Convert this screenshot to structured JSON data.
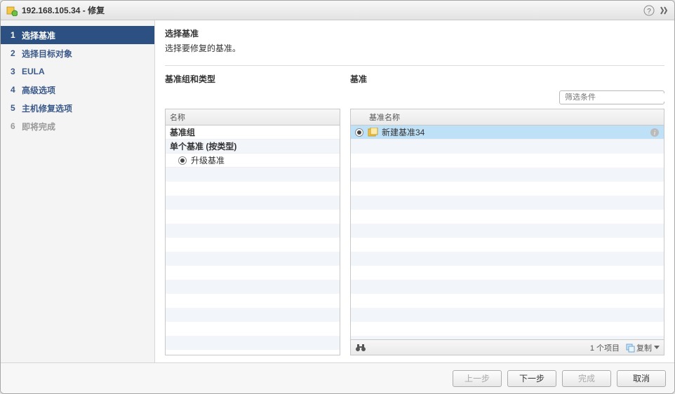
{
  "window": {
    "title": "192.168.105.34 - 修复"
  },
  "wizard": {
    "steps": [
      {
        "num": "1",
        "label": "选择基准",
        "state": "active"
      },
      {
        "num": "2",
        "label": "选择目标对象",
        "state": "normal"
      },
      {
        "num": "3",
        "label": "EULA",
        "state": "normal"
      },
      {
        "num": "4",
        "label": "高级选项",
        "state": "normal"
      },
      {
        "num": "5",
        "label": "主机修复选项",
        "state": "normal"
      },
      {
        "num": "6",
        "label": "即将完成",
        "state": "disabled"
      }
    ]
  },
  "page": {
    "title": "选择基准",
    "subtitle": "选择要修复的基准。"
  },
  "leftPanel": {
    "title": "基准组和类型",
    "header": "名称",
    "rows": [
      {
        "label": "基准组",
        "bold": true
      },
      {
        "label": "单个基准 (按类型)",
        "bold": true
      },
      {
        "label": "升级基准",
        "bold": false,
        "radio": true,
        "checked": true
      }
    ]
  },
  "rightPanel": {
    "title": "基准",
    "filterPlaceholder": "筛选条件",
    "header": "基准名称",
    "rows": [
      {
        "label": "新建基准34",
        "checked": true,
        "selected": true
      }
    ],
    "footer": {
      "count": "1 个项目",
      "copy": "复制"
    }
  },
  "buttons": {
    "back": "上一步",
    "next": "下一步",
    "finish": "完成",
    "cancel": "取消"
  }
}
